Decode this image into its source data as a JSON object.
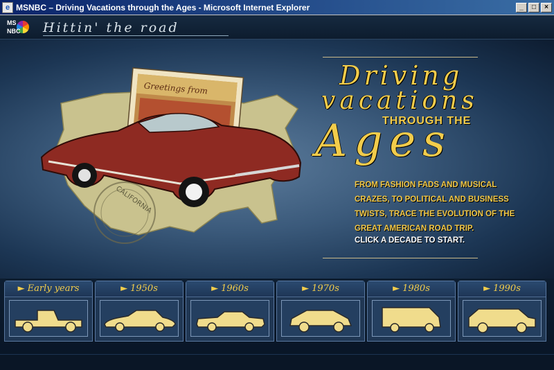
{
  "window": {
    "title": "MSNBC – Driving Vacations through the Ages - Microsoft Internet Explorer",
    "controls": [
      "minimize",
      "maximize",
      "close"
    ]
  },
  "header": {
    "logo_top": "MS",
    "logo_bottom": "NBC",
    "tagline": "Hittin' the road"
  },
  "hero": {
    "headline_line1": "Driving",
    "headline_line2": "vacations",
    "headline_line3": "THROUGH THE",
    "headline_line4": "Ages",
    "description": "From fashion fads and musical crazes, to political and business twists, trace the evolution of the great American road trip.",
    "cta": "CLICK A DECADE TO START.",
    "postcard_text": "Greetings from",
    "stamp_text": "CALIFORNIA"
  },
  "decades": [
    {
      "label": "Early years",
      "car": "truck-icon"
    },
    {
      "label": "1950s",
      "car": "sedan-1950s-icon"
    },
    {
      "label": "1960s",
      "car": "coupe-1960s-icon"
    },
    {
      "label": "1970s",
      "car": "hatchback-1970s-icon"
    },
    {
      "label": "1980s",
      "car": "van-1980s-icon"
    },
    {
      "label": "1990s",
      "car": "suv-1990s-icon"
    }
  ],
  "colors": {
    "accent": "#f2cc4b",
    "titlebar": "#0a246a",
    "background": "#3b5a7b"
  }
}
